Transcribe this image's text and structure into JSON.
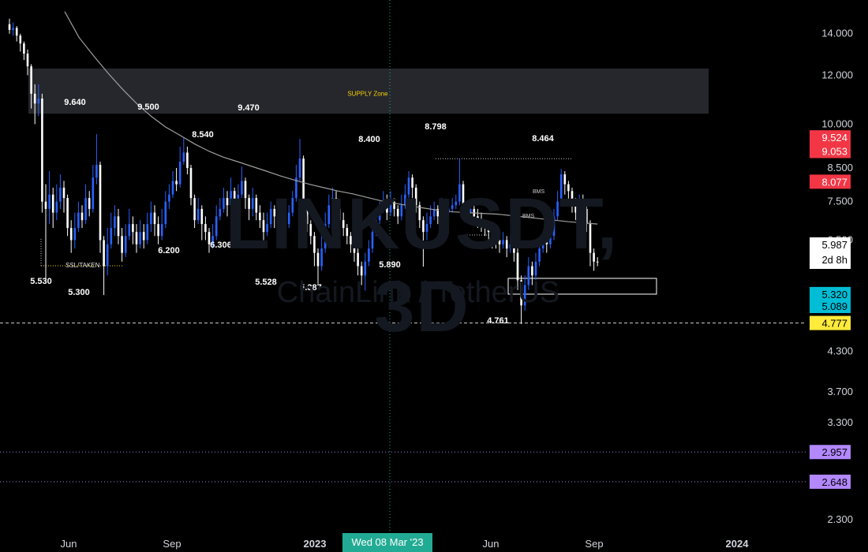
{
  "watermark": {
    "symbol": "LINKUSDT, 3D",
    "name": "ChainLink / TetherUS"
  },
  "annotations": {
    "supply_zone": "SUPPLY Zone",
    "ssl_taken": "SSL/TAKEN",
    "bms_1": "BMS",
    "bms_2": "BMS"
  },
  "price_axis": {
    "ticks": [
      "14.000",
      "12.000",
      "10.000",
      "8.500",
      "7.500",
      "6.500",
      "4.300",
      "3.700",
      "3.300",
      "2.300"
    ],
    "badges": {
      "b9524": "9.524",
      "b9053": "9.053",
      "b8077": "8.077",
      "last_price": "5.987",
      "countdown": "2d 8h",
      "b5320": "5.320",
      "b5089": "5.089",
      "b4777": "4.777",
      "b2957": "2.957",
      "b2648": "2.648"
    }
  },
  "time_axis": {
    "labels": [
      "Jun",
      "Sep",
      "2023",
      "Jun",
      "Sep",
      "2024"
    ],
    "cursor": "Wed 08 Mar '23"
  },
  "colors": {
    "up": "#2962ff",
    "down": "#ffffff",
    "ema": "#9e9e9e",
    "red_badge": "#f23645",
    "cyan_badge": "#00bcd4",
    "yellow_badge": "#ffeb3b",
    "purple_badge": "#b388ff",
    "crosshair": "#22ab94"
  },
  "chart_data": {
    "type": "candlestick",
    "symbol": "LINKUSDT",
    "timeframe": "3D",
    "y_scale": "log",
    "ylim": [
      2.1,
      15.5
    ],
    "labeled_swing_points": [
      {
        "label": "9.640",
        "price": 9.64
      },
      {
        "label": "5.530",
        "price": 5.53
      },
      {
        "label": "5.300",
        "price": 5.3
      },
      {
        "label": "9.500",
        "price": 9.5
      },
      {
        "label": "6.200",
        "price": 6.2
      },
      {
        "label": "8.540",
        "price": 8.54
      },
      {
        "label": "6.306",
        "price": 6.306
      },
      {
        "label": "9.470",
        "price": 9.47
      },
      {
        "label": "5.528",
        "price": 5.528
      },
      {
        "label": "5.387",
        "price": 5.387
      },
      {
        "label": "8.400",
        "price": 8.4
      },
      {
        "label": "5.890",
        "price": 5.89
      },
      {
        "label": "8.798",
        "price": 8.798
      },
      {
        "label": "4.761",
        "price": 4.761
      },
      {
        "label": "8.464",
        "price": 8.464
      }
    ],
    "candles": [
      [
        14.5,
        14.2,
        14.8,
        14.0
      ],
      [
        14.2,
        14.3,
        14.6,
        13.9
      ],
      [
        14.3,
        13.9,
        14.4,
        13.6
      ],
      [
        13.9,
        13.5,
        14.0,
        13.1
      ],
      [
        13.5,
        13.0,
        13.6,
        12.7
      ],
      [
        13.0,
        12.4,
        13.2,
        12.0
      ],
      [
        12.4,
        11.2,
        12.5,
        10.6
      ],
      [
        11.2,
        10.8,
        11.6,
        10.0
      ],
      [
        10.8,
        11.0,
        11.6,
        10.3
      ],
      [
        11.0,
        7.5,
        11.2,
        7.2
      ],
      [
        7.5,
        7.3,
        8.0,
        5.53
      ],
      [
        7.3,
        7.7,
        8.4,
        6.9
      ],
      [
        7.7,
        7.2,
        7.9,
        6.8
      ],
      [
        7.2,
        7.5,
        8.0,
        7.0
      ],
      [
        7.5,
        7.9,
        8.3,
        7.3
      ],
      [
        7.9,
        7.6,
        8.1,
        7.2
      ],
      [
        7.6,
        6.8,
        7.7,
        6.6
      ],
      [
        6.8,
        6.5,
        7.0,
        6.2
      ],
      [
        6.5,
        6.8,
        7.2,
        6.3
      ],
      [
        6.8,
        7.2,
        7.5,
        6.7
      ],
      [
        7.2,
        7.0,
        7.4,
        6.8
      ],
      [
        7.0,
        7.6,
        8.0,
        6.9
      ],
      [
        7.6,
        7.3,
        7.8,
        7.1
      ],
      [
        7.3,
        8.2,
        8.6,
        7.2
      ],
      [
        8.2,
        8.6,
        9.64,
        8.0
      ],
      [
        8.6,
        6.5,
        8.7,
        6.2
      ],
      [
        6.5,
        5.9,
        6.6,
        5.3
      ],
      [
        5.9,
        6.4,
        6.8,
        5.7
      ],
      [
        6.4,
        6.8,
        7.2,
        6.3
      ],
      [
        6.8,
        7.1,
        7.4,
        6.6
      ],
      [
        7.1,
        6.6,
        7.3,
        6.4
      ],
      [
        6.6,
        6.2,
        6.8,
        6.0
      ],
      [
        6.2,
        6.6,
        6.9,
        6.1
      ],
      [
        6.6,
        6.9,
        7.3,
        6.5
      ],
      [
        6.9,
        6.7,
        7.1,
        6.4
      ],
      [
        6.7,
        6.4,
        6.9,
        6.2
      ],
      [
        6.4,
        6.7,
        7.0,
        6.3
      ],
      [
        6.7,
        6.5,
        6.9,
        6.3
      ],
      [
        6.5,
        6.9,
        7.2,
        6.4
      ],
      [
        6.9,
        7.2,
        7.5,
        6.7
      ],
      [
        7.2,
        6.9,
        7.4,
        6.6
      ],
      [
        6.9,
        6.6,
        7.1,
        6.4
      ],
      [
        6.6,
        6.9,
        7.3,
        6.5
      ],
      [
        6.9,
        7.5,
        7.8,
        6.8
      ],
      [
        7.5,
        7.7,
        8.0,
        7.3
      ],
      [
        7.7,
        8.1,
        8.4,
        7.6
      ],
      [
        8.1,
        8.0,
        8.5,
        7.8
      ],
      [
        8.0,
        8.7,
        9.2,
        7.9
      ],
      [
        8.7,
        9.0,
        9.5,
        8.6
      ],
      [
        9.0,
        8.5,
        9.2,
        8.3
      ],
      [
        8.5,
        7.6,
        8.6,
        7.4
      ],
      [
        7.6,
        7.0,
        7.7,
        6.8
      ],
      [
        7.0,
        7.3,
        7.6,
        6.9
      ],
      [
        7.3,
        6.9,
        7.4,
        6.5
      ],
      [
        6.9,
        6.7,
        7.1,
        6.5
      ],
      [
        6.7,
        6.4,
        6.8,
        6.2
      ],
      [
        6.4,
        6.6,
        6.9,
        6.3
      ],
      [
        6.6,
        7.1,
        7.4,
        6.5
      ],
      [
        7.1,
        7.3,
        7.6,
        7.0
      ],
      [
        7.3,
        7.6,
        7.9,
        7.2
      ],
      [
        7.6,
        7.4,
        7.8,
        7.1
      ],
      [
        7.4,
        7.8,
        8.2,
        7.3
      ],
      [
        7.8,
        7.5,
        7.9,
        7.2
      ],
      [
        7.5,
        7.7,
        8.0,
        7.3
      ],
      [
        7.7,
        8.1,
        8.54,
        7.6
      ],
      [
        8.1,
        7.6,
        8.2,
        7.3
      ],
      [
        7.6,
        7.3,
        7.7,
        7.0
      ],
      [
        7.3,
        7.6,
        7.9,
        7.1
      ],
      [
        7.6,
        7.2,
        7.7,
        7.0
      ],
      [
        7.2,
        7.0,
        7.4,
        6.8
      ],
      [
        7.0,
        6.7,
        7.2,
        6.5
      ],
      [
        6.7,
        6.9,
        7.2,
        6.6
      ],
      [
        6.9,
        7.3,
        7.5,
        6.8
      ],
      [
        7.3,
        7.1,
        7.4,
        6.8
      ],
      [
        7.1,
        6.8,
        7.2,
        6.6
      ],
      [
        6.8,
        6.6,
        6.9,
        6.306
      ],
      [
        6.6,
        6.9,
        7.1,
        6.5
      ],
      [
        6.9,
        7.2,
        7.4,
        6.8
      ],
      [
        7.2,
        7.6,
        7.8,
        7.1
      ],
      [
        7.6,
        8.2,
        8.6,
        7.5
      ],
      [
        8.2,
        8.8,
        9.47,
        8.1
      ],
      [
        8.8,
        7.4,
        8.9,
        7.2
      ],
      [
        7.4,
        6.9,
        7.5,
        6.7
      ],
      [
        6.9,
        6.6,
        7.0,
        6.4
      ],
      [
        6.6,
        6.2,
        6.7,
        5.9
      ],
      [
        6.2,
        5.9,
        6.3,
        5.528
      ],
      [
        5.9,
        6.3,
        6.6,
        5.8
      ],
      [
        6.3,
        6.9,
        7.2,
        6.2
      ],
      [
        6.9,
        7.4,
        7.7,
        6.8
      ],
      [
        7.4,
        7.6,
        7.9,
        7.3
      ],
      [
        7.6,
        7.3,
        7.8,
        7.1
      ],
      [
        7.3,
        7.0,
        7.4,
        6.8
      ],
      [
        7.0,
        6.8,
        7.2,
        6.6
      ],
      [
        6.8,
        6.6,
        6.9,
        6.4
      ],
      [
        6.6,
        6.4,
        6.7,
        6.2
      ],
      [
        6.4,
        6.2,
        6.5,
        6.0
      ],
      [
        6.2,
        5.9,
        6.3,
        5.7
      ],
      [
        5.9,
        5.7,
        6.0,
        5.5
      ],
      [
        5.7,
        6.0,
        6.2,
        5.387
      ],
      [
        6.0,
        6.3,
        6.5,
        5.9
      ],
      [
        6.3,
        6.7,
        6.9,
        6.2
      ],
      [
        6.7,
        7.0,
        7.3,
        6.6
      ],
      [
        7.0,
        7.3,
        7.5,
        6.9
      ],
      [
        7.3,
        7.5,
        7.8,
        7.2
      ],
      [
        7.5,
        7.2,
        7.7,
        7.0
      ],
      [
        7.2,
        7.5,
        7.8,
        7.1
      ],
      [
        7.5,
        7.3,
        7.6,
        7.1
      ],
      [
        7.3,
        7.1,
        7.4,
        6.9
      ],
      [
        7.1,
        7.4,
        7.7,
        7.0
      ],
      [
        7.4,
        7.7,
        8.0,
        7.3
      ],
      [
        7.7,
        8.2,
        8.4,
        7.6
      ],
      [
        8.2,
        7.9,
        8.3,
        7.6
      ],
      [
        7.9,
        7.4,
        8.0,
        7.2
      ],
      [
        7.4,
        7.0,
        7.5,
        6.8
      ],
      [
        7.0,
        6.7,
        7.1,
        5.89
      ],
      [
        6.7,
        6.9,
        7.2,
        6.5
      ],
      [
        6.9,
        7.1,
        7.4,
        6.8
      ],
      [
        7.1,
        7.3,
        7.5,
        7.0
      ],
      [
        7.3,
        7.1,
        7.4,
        6.9
      ],
      [
        7.1,
        7.4,
        7.6,
        7.0
      ],
      [
        7.4,
        7.2,
        7.5,
        7.0
      ],
      [
        7.2,
        7.3,
        7.5,
        7.1
      ],
      [
        7.3,
        7.4,
        7.6,
        7.2
      ],
      [
        7.4,
        7.5,
        7.7,
        7.3
      ],
      [
        7.5,
        8.0,
        8.798,
        7.4
      ],
      [
        8.0,
        7.4,
        8.1,
        7.2
      ],
      [
        7.4,
        7.2,
        7.5,
        7.0
      ],
      [
        7.2,
        7.3,
        7.5,
        7.0
      ],
      [
        7.3,
        7.1,
        7.4,
        6.9
      ],
      [
        7.1,
        7.0,
        7.3,
        6.8
      ],
      [
        7.0,
        6.9,
        7.2,
        6.7
      ],
      [
        6.9,
        6.8,
        7.0,
        6.6
      ],
      [
        6.8,
        6.7,
        6.9,
        6.5
      ],
      [
        6.7,
        6.6,
        6.8,
        6.3
      ],
      [
        6.6,
        6.5,
        6.7,
        6.3
      ],
      [
        6.5,
        6.4,
        6.6,
        6.2
      ],
      [
        6.4,
        6.5,
        6.7,
        6.3
      ],
      [
        6.5,
        6.3,
        6.6,
        6.1
      ],
      [
        6.3,
        6.4,
        6.6,
        6.2
      ],
      [
        6.4,
        6.2,
        6.5,
        6.0
      ],
      [
        6.2,
        5.6,
        6.3,
        5.4
      ],
      [
        5.6,
        5.1,
        5.7,
        4.761
      ],
      [
        5.1,
        5.5,
        5.7,
        5.0
      ],
      [
        5.5,
        5.9,
        6.1,
        5.4
      ],
      [
        5.9,
        5.7,
        6.0,
        5.5
      ],
      [
        5.7,
        6.0,
        6.2,
        5.6
      ],
      [
        6.0,
        6.3,
        6.5,
        5.9
      ],
      [
        6.3,
        6.5,
        6.7,
        6.2
      ],
      [
        6.5,
        6.4,
        6.7,
        6.2
      ],
      [
        6.4,
        6.6,
        6.8,
        6.3
      ],
      [
        6.6,
        7.1,
        7.3,
        6.5
      ],
      [
        7.1,
        7.5,
        7.8,
        7.0
      ],
      [
        7.5,
        8.3,
        8.464,
        7.4
      ],
      [
        8.3,
        8.0,
        8.4,
        7.7
      ],
      [
        8.0,
        7.8,
        8.1,
        7.5
      ],
      [
        7.8,
        7.5,
        7.9,
        7.2
      ],
      [
        7.5,
        7.2,
        7.6,
        7.0
      ],
      [
        7.2,
        7.5,
        7.7,
        7.1
      ],
      [
        7.5,
        7.3,
        7.7,
        7.1
      ],
      [
        7.3,
        6.9,
        7.4,
        6.7
      ],
      [
        6.9,
        6.2,
        7.0,
        5.9
      ],
      [
        6.2,
        6.0,
        6.3,
        5.8
      ],
      [
        6.0,
        5.987,
        6.1,
        5.9
      ]
    ],
    "ema": [
      15.2,
      13.8,
      12.9,
      12.1,
      11.4,
      10.8,
      10.3,
      9.9,
      9.6,
      9.3,
      9.05,
      8.85,
      8.7,
      8.55,
      8.4,
      8.25,
      8.12,
      8.0,
      7.9,
      7.8,
      7.72,
      7.62,
      7.52,
      7.45,
      7.38,
      7.32,
      7.26,
      7.22,
      7.2,
      7.18,
      7.16,
      7.12,
      7.08,
      7.04,
      7.0,
      6.96,
      6.93,
      6.9
    ]
  }
}
